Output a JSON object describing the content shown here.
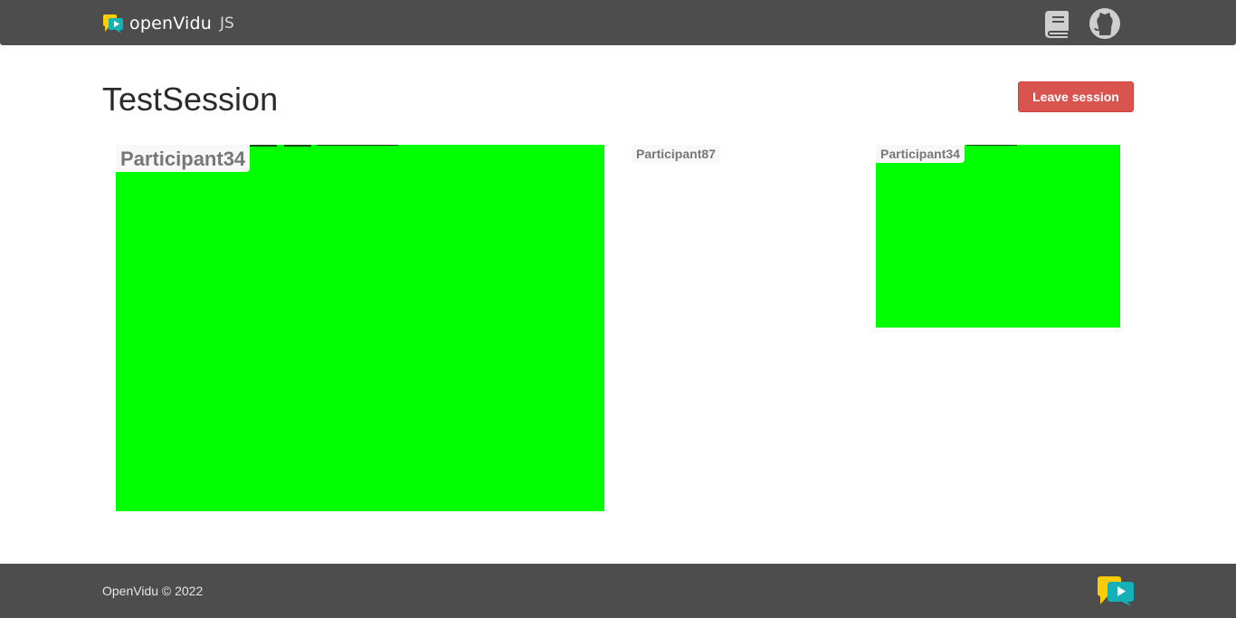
{
  "navbar": {
    "brand_name": "openVidu",
    "brand_suffix": "JS",
    "docs_icon": "book-icon",
    "github_icon": "github-icon"
  },
  "session": {
    "title": "TestSession",
    "leave_label": "Leave session"
  },
  "videos": {
    "main_participant": "Participant34",
    "subscriber_participant": "Participant87",
    "publisher_participant": "Participant34"
  },
  "footer": {
    "copyright": "OpenVidu © 2022",
    "logo_icon": "openvidu-logo-icon"
  },
  "colors": {
    "navbar_bg": "#4d4d4d",
    "video_bg": "#00ff00",
    "leave_button_bg": "#d9534f",
    "logo_yellow": "#ffcc00",
    "logo_teal": "#16b1b7"
  }
}
